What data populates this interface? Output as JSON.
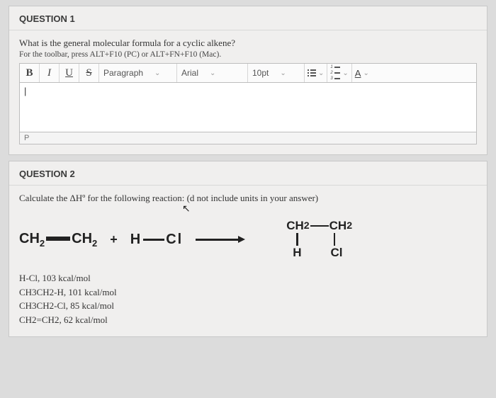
{
  "q1": {
    "header": "QUESTION 1",
    "prompt": "What is the general molecular formula for a cyclic alkene?",
    "hint": "For the toolbar, press ALT+F10 (PC) or ALT+FN+F10 (Mac).",
    "toolbar": {
      "bold": "B",
      "italic": "I",
      "underline": "U",
      "strike": "S",
      "para": "Paragraph",
      "font": "Arial",
      "size": "10pt",
      "a": "A"
    },
    "editor_content": "|",
    "status_left": "P",
    "status_right": ""
  },
  "q2": {
    "header": "QUESTION 2",
    "prompt": "Calculate the ΔHº for the following reaction: (d not include units in your answer)",
    "reactant1": {
      "left": "CH",
      "sub1": "2",
      "right": "CH",
      "sub2": "2"
    },
    "plus": "+",
    "reactant2": {
      "h": "H",
      "cl": "Cl"
    },
    "product": {
      "tl": "CH",
      "tlsub": "2",
      "tr": "CH",
      "trsub": "2",
      "bl": "H",
      "br": "Cl"
    },
    "bonds": [
      "H-Cl, 103 kcal/mol",
      "CH3CH2-H, 101 kcal/mol",
      "CH3CH2-Cl, 85 kcal/mol",
      "CH2=CH2, 62 kcal/mol"
    ]
  }
}
